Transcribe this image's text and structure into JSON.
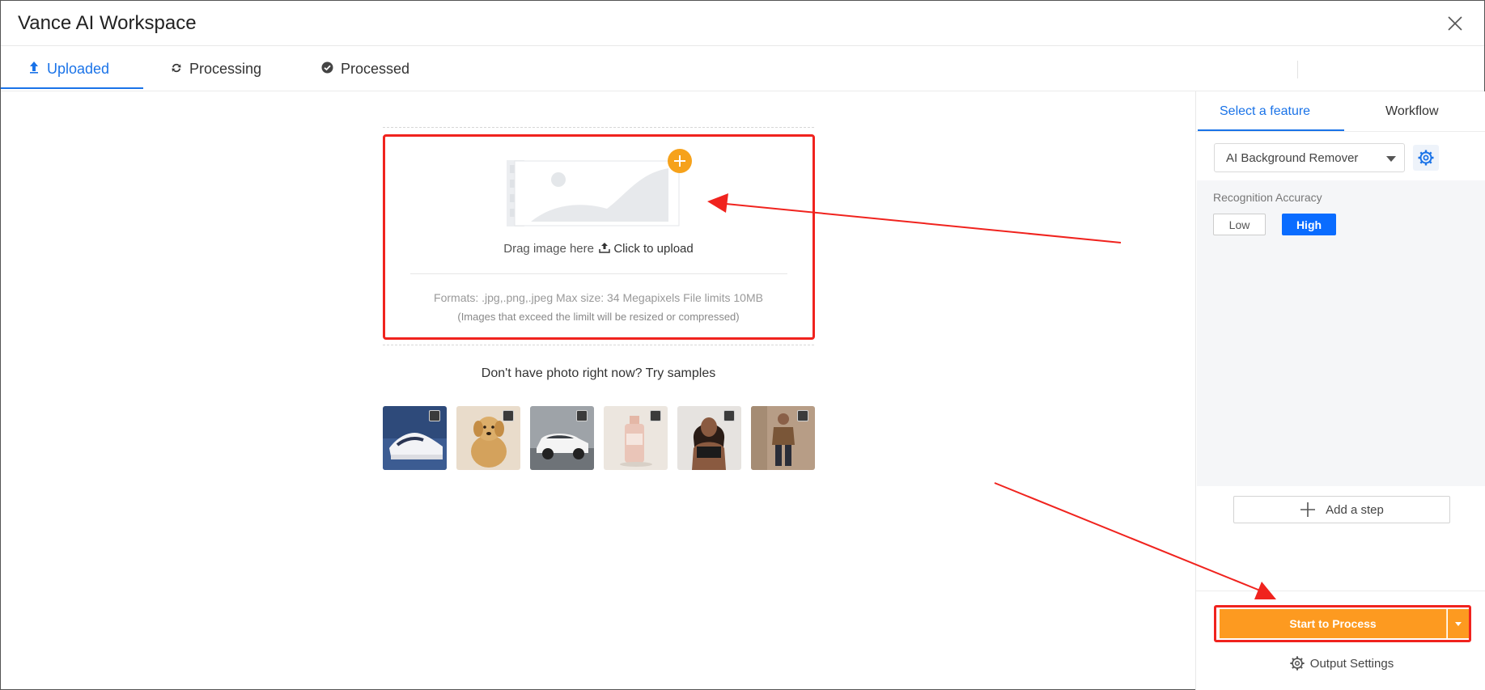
{
  "window": {
    "title": "Vance AI Workspace"
  },
  "tabs": [
    {
      "label": "Uploaded",
      "icon": "upload-arrow-icon",
      "active": true
    },
    {
      "label": "Processing",
      "icon": "refresh-icon",
      "active": false
    },
    {
      "label": "Processed",
      "icon": "check-circle-icon",
      "active": false
    }
  ],
  "upload": {
    "drag_text": "Drag image here",
    "click_text": "Click to upload",
    "formats": "Formats: .jpg,.png,.jpeg Max size: 34 Megapixels File limits 10MB",
    "note": "(Images that exceed the limilt will be resized or compressed)"
  },
  "samples": {
    "title": "Don't have photo right now? Try samples",
    "items": [
      {
        "icon": "sneaker-photo"
      },
      {
        "icon": "dog-photo"
      },
      {
        "icon": "car-photo"
      },
      {
        "icon": "bottle-photo"
      },
      {
        "icon": "woman-photo"
      },
      {
        "icon": "man-photo"
      }
    ]
  },
  "sidebar": {
    "tabs": [
      {
        "label": "Select a feature",
        "active": true
      },
      {
        "label": "Workflow",
        "active": false
      }
    ],
    "feature": {
      "selected": "AI Background Remover"
    },
    "options": {
      "label": "Recognition Accuracy",
      "low": "Low",
      "high": "High",
      "selected": "High"
    },
    "add_step": "Add a step",
    "start_label": "Start to Process",
    "output_settings": "Output Settings"
  },
  "colors": {
    "accent": "#1a73e8",
    "primary_button": "#fd9a20",
    "annotation": "#f0231e",
    "plus_badge": "#f6a21b"
  }
}
